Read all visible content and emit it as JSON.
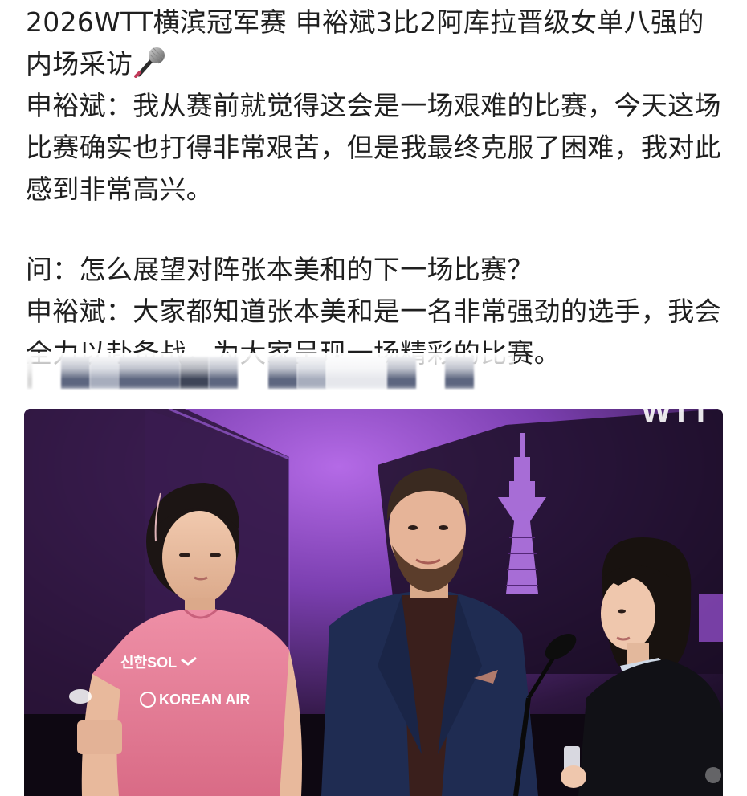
{
  "post": {
    "headline": "2026WTT横滨冠军赛 申裕斌3比2阿库拉晋级女单八强的内场采访",
    "answer1": "申裕斌：我从赛前就觉得这会是一场艰难的比赛，今天这场比赛确实也打得非常艰苦，但是我最终克服了困难，我对此感到非常高兴。",
    "question": "问：怎么展望对阵张本美和的下一场比赛？",
    "answer2": "申裕斌：大家都知道张本美和是一名非常强劲的选手，我会全力以赴备战，为大家呈现一场精彩的比赛。",
    "mic_icon": "microphone-emoji"
  },
  "photo": {
    "backdrop_logo": "WTT",
    "shirt_sponsor_top": "신한SOL",
    "shirt_sponsor_main": "KOREAN AIR",
    "colors": {
      "stage_purple": "#7b3fb0",
      "shirt_pink": "#e87f98",
      "jacket_navy": "#1f2c52"
    }
  }
}
